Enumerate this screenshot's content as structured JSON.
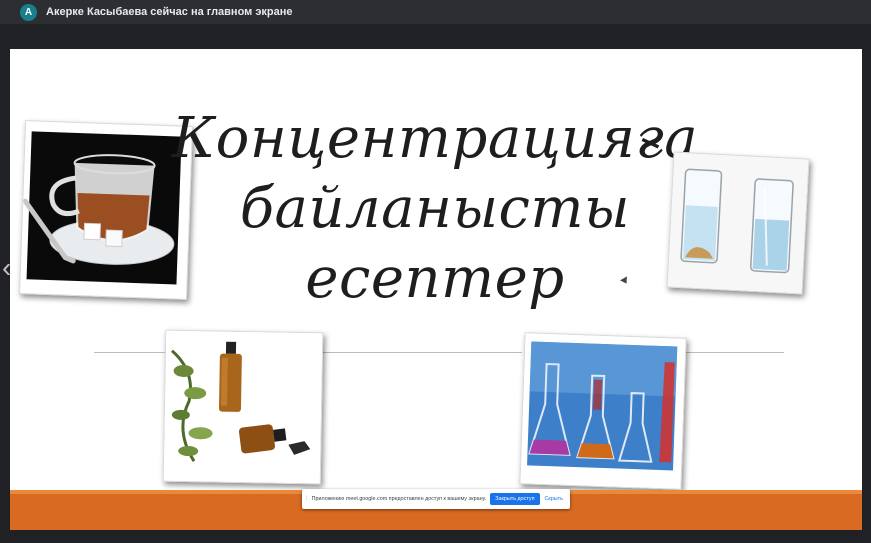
{
  "banner": {
    "avatar_letter": "A",
    "share_message": "Акерке Касыбаева сейчас на главном экране"
  },
  "slide": {
    "title_lines": [
      "Концентрацияға",
      "байланысты",
      "есептер"
    ],
    "images": {
      "tea": "tea-cup-with-sugar-image",
      "test_tubes": "test-tubes-image",
      "bottles": "herb-bottles-image",
      "flasks": "lab-flasks-image"
    },
    "colors": {
      "accent_bar": "#d86a22",
      "accent_bar_top": "#e98a3a"
    }
  },
  "notification": {
    "message": "Приложению meet.google.com предоставлен доступ к вашему экрану.",
    "stop_button": "Закрыть доступ",
    "hide_link": "Скрыть"
  },
  "icons": {
    "prev": "chevron-left-icon",
    "grip": "drag-handle-icon"
  }
}
